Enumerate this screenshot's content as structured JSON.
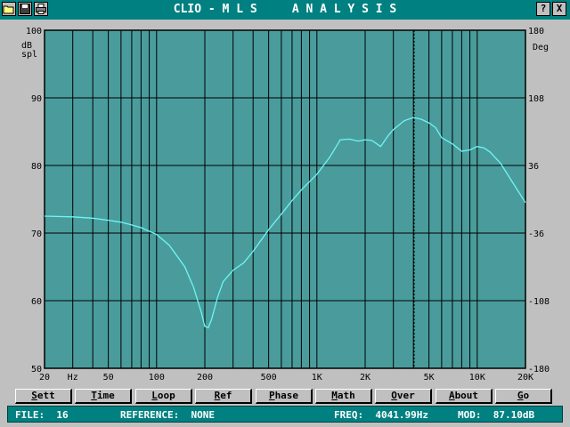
{
  "window": {
    "title": "CLIO - M L S     A N A L Y S I S",
    "left_icons": [
      "folder-open-icon",
      "save-disk-icon",
      "printer-icon"
    ],
    "help_button": "?",
    "close_button": "X"
  },
  "plot": {
    "left_unit_top": "dB",
    "left_unit_bottom": "spl",
    "right_unit": "Deg",
    "left_ticks": [
      "100",
      "90",
      "80",
      "70",
      "60",
      "50"
    ],
    "right_ticks": [
      "180",
      "108",
      "36",
      "-36",
      "-108",
      "-180"
    ],
    "x_ticks": [
      "20",
      "Hz",
      "50",
      "100",
      "200",
      "500",
      "1K",
      "2K",
      "5K",
      "10K",
      "20K"
    ],
    "cursor_freq_hz": 4041.99,
    "colors": {
      "background": "#4a9c9c",
      "curve": "#6ff5f5",
      "grid": "#000000"
    }
  },
  "menu_buttons": [
    {
      "label": "Sett",
      "underline": "S",
      "rest": "ett"
    },
    {
      "label": "Time",
      "underline": "T",
      "rest": "ime"
    },
    {
      "label": "Loop",
      "underline": "L",
      "rest": "oop"
    },
    {
      "label": "Ref",
      "underline": "R",
      "rest": "ef"
    },
    {
      "label": "Phase",
      "underline": "P",
      "rest": "hase"
    },
    {
      "label": "Math",
      "underline": "M",
      "rest": "ath"
    },
    {
      "label": "Over",
      "underline": "O",
      "rest": "ver"
    },
    {
      "label": "About",
      "underline": "A",
      "rest": "bout"
    },
    {
      "label": "Go",
      "underline": "G",
      "rest": "o"
    }
  ],
  "status": {
    "file": "FILE:  16",
    "reference": "REFERENCE:  NONE",
    "freq": "FREQ:  4041.99Hz",
    "mod": "MOD:  87.10dB"
  },
  "chart_data": {
    "type": "line",
    "title": "",
    "xlabel": "Hz",
    "ylabel": "dB spl",
    "y2label": "Deg",
    "x_scale": "log",
    "xlim": [
      20,
      20000
    ],
    "ylim": [
      50,
      100
    ],
    "y2lim": [
      -180,
      180
    ],
    "grid": true,
    "series": [
      {
        "x": [
          20,
          30,
          40,
          50,
          60,
          70,
          80,
          100,
          120,
          150,
          170,
          190,
          200,
          210,
          220,
          240,
          260,
          300,
          350,
          400,
          450,
          500,
          600,
          700,
          800,
          900,
          1000,
          1200,
          1400,
          1600,
          1800,
          2000,
          2200,
          2500,
          2800,
          3000,
          3500,
          4000,
          4500,
          5000,
          5500,
          6000,
          7000,
          8000,
          9000,
          10000,
          11000,
          12000,
          14000,
          16000,
          18000,
          20000
        ],
        "y": [
          72.5,
          72.4,
          72.2,
          71.9,
          71.6,
          71.2,
          70.8,
          69.8,
          68.2,
          65.0,
          62.0,
          58.3,
          56.2,
          56.0,
          57.2,
          60.5,
          62.8,
          64.5,
          65.6,
          67.3,
          69.0,
          70.5,
          72.8,
          74.8,
          76.4,
          77.6,
          78.7,
          81.2,
          83.8,
          83.9,
          83.6,
          83.8,
          83.7,
          82.8,
          84.5,
          85.3,
          86.6,
          87.1,
          86.8,
          86.3,
          85.6,
          84.1,
          83.2,
          82.1,
          82.3,
          82.8,
          82.6,
          82.0,
          80.3,
          78.1,
          76.2,
          74.5
        ]
      }
    ]
  }
}
